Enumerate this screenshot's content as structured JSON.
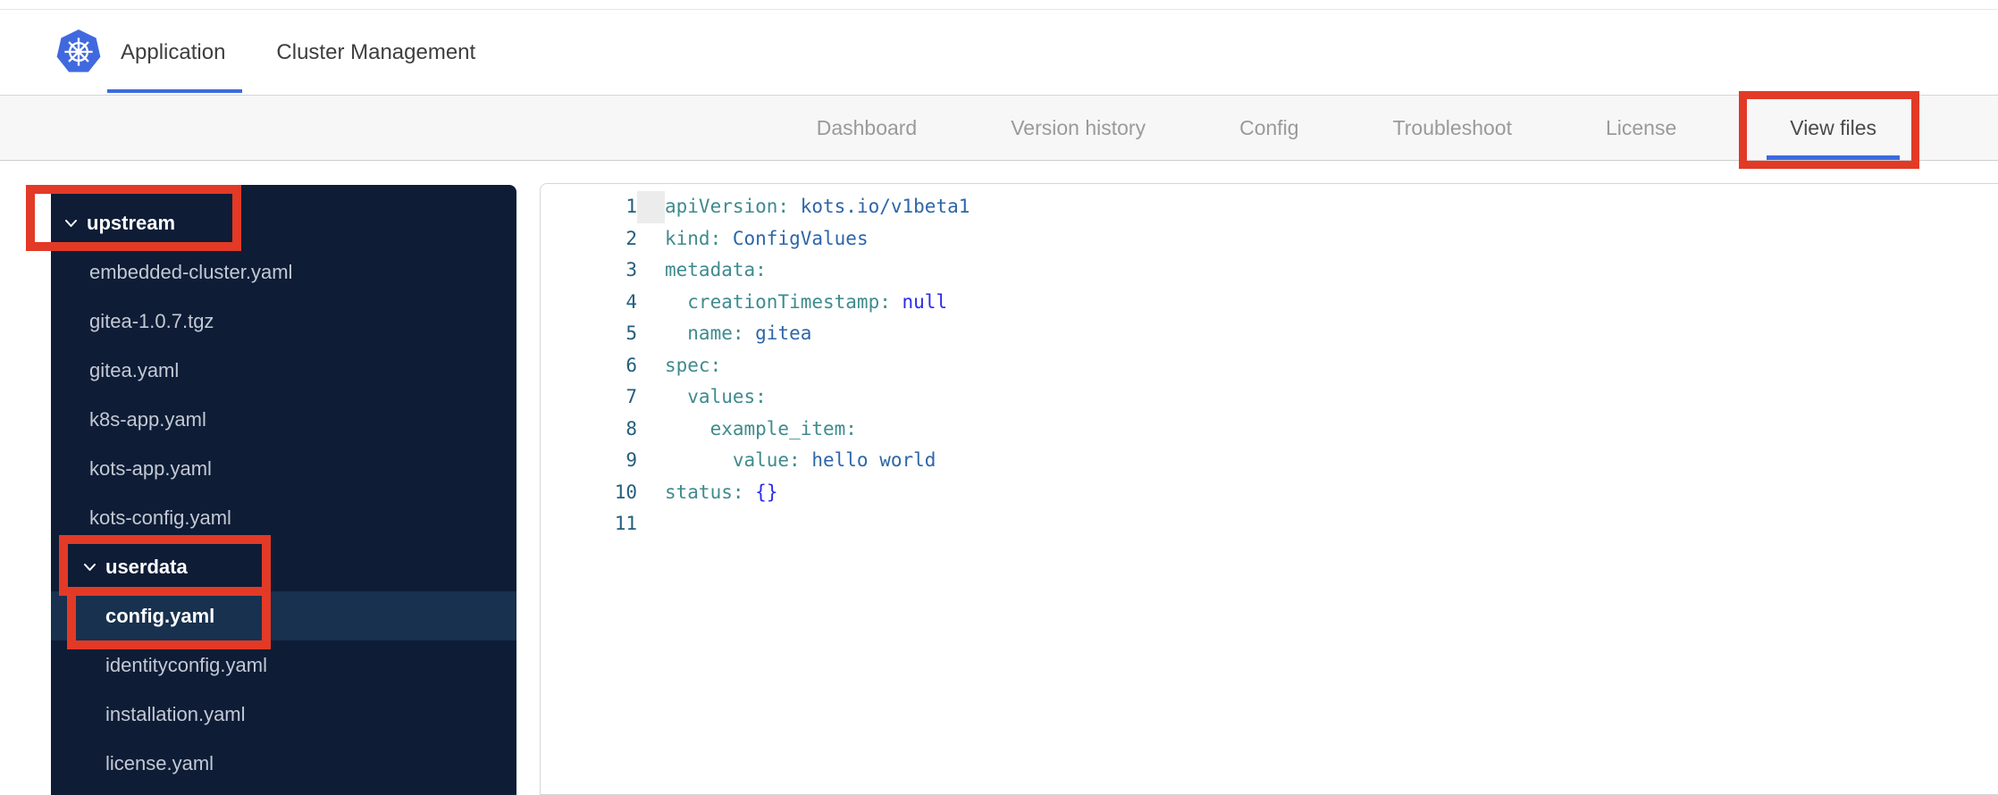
{
  "header": {
    "logo": "kubernetes",
    "tabs": [
      {
        "label": "Application",
        "active": true
      },
      {
        "label": "Cluster Management",
        "active": false
      }
    ]
  },
  "nav": {
    "tabs": [
      {
        "label": "Dashboard",
        "active": false
      },
      {
        "label": "Version history",
        "active": false
      },
      {
        "label": "Config",
        "active": false
      },
      {
        "label": "Troubleshoot",
        "active": false
      },
      {
        "label": "License",
        "active": false
      },
      {
        "label": "View files",
        "active": true
      }
    ]
  },
  "file_tree": {
    "items": [
      {
        "label": "upstream",
        "type": "folder",
        "expanded": true,
        "indent": 0,
        "selected": false
      },
      {
        "label": "embedded-cluster.yaml",
        "type": "file",
        "indent": 1,
        "selected": false
      },
      {
        "label": "gitea-1.0.7.tgz",
        "type": "file",
        "indent": 1,
        "selected": false
      },
      {
        "label": "gitea.yaml",
        "type": "file",
        "indent": 1,
        "selected": false
      },
      {
        "label": "k8s-app.yaml",
        "type": "file",
        "indent": 1,
        "selected": false
      },
      {
        "label": "kots-app.yaml",
        "type": "file",
        "indent": 1,
        "selected": false
      },
      {
        "label": "kots-config.yaml",
        "type": "file",
        "indent": 1,
        "selected": false
      },
      {
        "label": "userdata",
        "type": "folder",
        "expanded": true,
        "indent": 1,
        "selected": false
      },
      {
        "label": "config.yaml",
        "type": "file",
        "indent": 2,
        "selected": true
      },
      {
        "label": "identityconfig.yaml",
        "type": "file",
        "indent": 2,
        "selected": false
      },
      {
        "label": "installation.yaml",
        "type": "file",
        "indent": 2,
        "selected": false
      },
      {
        "label": "license.yaml",
        "type": "file",
        "indent": 2,
        "selected": false
      }
    ]
  },
  "editor": {
    "language": "yaml",
    "lines": [
      {
        "num": 1,
        "indent": 0,
        "tokens": [
          [
            "key",
            "apiVersion:"
          ],
          [
            "plain",
            " "
          ],
          [
            "str",
            "kots.io/v1beta1"
          ]
        ]
      },
      {
        "num": 2,
        "indent": 0,
        "tokens": [
          [
            "key",
            "kind:"
          ],
          [
            "plain",
            " "
          ],
          [
            "str",
            "ConfigValues"
          ]
        ]
      },
      {
        "num": 3,
        "indent": 0,
        "tokens": [
          [
            "key",
            "metadata:"
          ]
        ]
      },
      {
        "num": 4,
        "indent": 2,
        "tokens": [
          [
            "key",
            "creationTimestamp:"
          ],
          [
            "plain",
            " "
          ],
          [
            "const",
            "null"
          ]
        ]
      },
      {
        "num": 5,
        "indent": 2,
        "tokens": [
          [
            "key",
            "name:"
          ],
          [
            "plain",
            " "
          ],
          [
            "str",
            "gitea"
          ]
        ]
      },
      {
        "num": 6,
        "indent": 0,
        "tokens": [
          [
            "key",
            "spec:"
          ]
        ]
      },
      {
        "num": 7,
        "indent": 2,
        "tokens": [
          [
            "key",
            "values:"
          ]
        ]
      },
      {
        "num": 8,
        "indent": 4,
        "tokens": [
          [
            "key",
            "example_item:"
          ]
        ]
      },
      {
        "num": 9,
        "indent": 6,
        "tokens": [
          [
            "key",
            "value:"
          ],
          [
            "plain",
            " "
          ],
          [
            "str",
            "hello world"
          ]
        ]
      },
      {
        "num": 10,
        "indent": 0,
        "tokens": [
          [
            "key",
            "status:"
          ],
          [
            "plain",
            " "
          ],
          [
            "const",
            "{}"
          ]
        ]
      },
      {
        "num": 11,
        "indent": 0,
        "tokens": []
      }
    ]
  },
  "annotations": {
    "color": "#E23A26",
    "targets": [
      "View files tab",
      "upstream folder",
      "userdata folder",
      "config.yaml file"
    ]
  },
  "colors": {
    "accent-blue": "#3B6BDE",
    "logo-blue": "#4169DF",
    "red": "#E23A26",
    "sidebar-bg": "#0E1C36",
    "sidebar-sel": "#17314F",
    "tk-key": "#3E8B8E",
    "tk-str": "#2D66A8",
    "tk-const": "#2B2BE8"
  }
}
